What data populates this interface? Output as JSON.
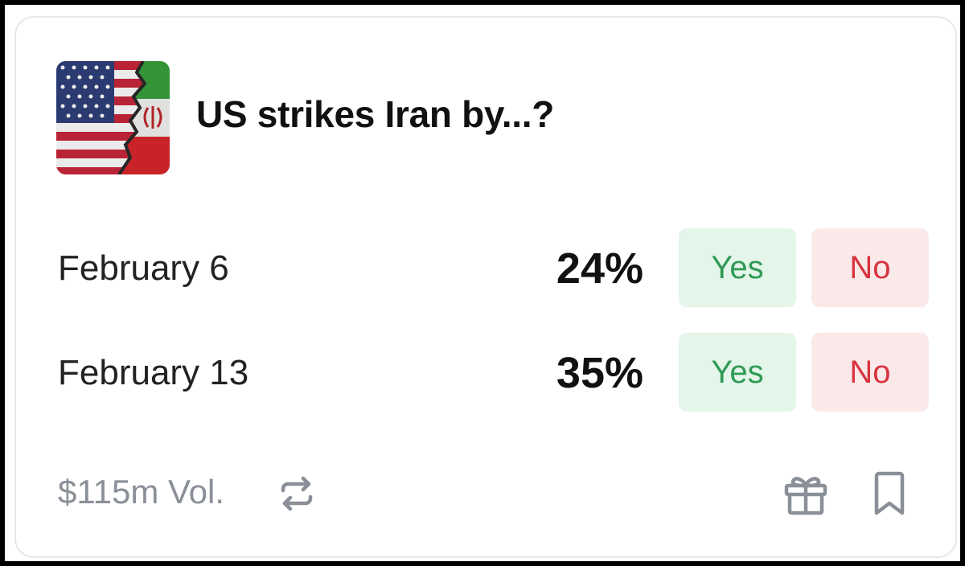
{
  "market": {
    "title": "US strikes Iran by...?",
    "thumbnail_icon": "us-iran-flags-icon",
    "outcomes": [
      {
        "label": "February 6",
        "probability": "24%",
        "yes_label": "Yes",
        "no_label": "No"
      },
      {
        "label": "February 13",
        "probability": "35%",
        "yes_label": "Yes",
        "no_label": "No"
      }
    ],
    "volume": "$115m Vol."
  },
  "icons": {
    "repeat": "repeat-icon",
    "gift": "gift-icon",
    "bookmark": "bookmark-icon"
  },
  "colors": {
    "yes_bg": "#e4f5e9",
    "yes_text": "#2f9a55",
    "no_bg": "#fbe9ea",
    "no_text": "#d8343e",
    "muted": "#8a8f98"
  }
}
